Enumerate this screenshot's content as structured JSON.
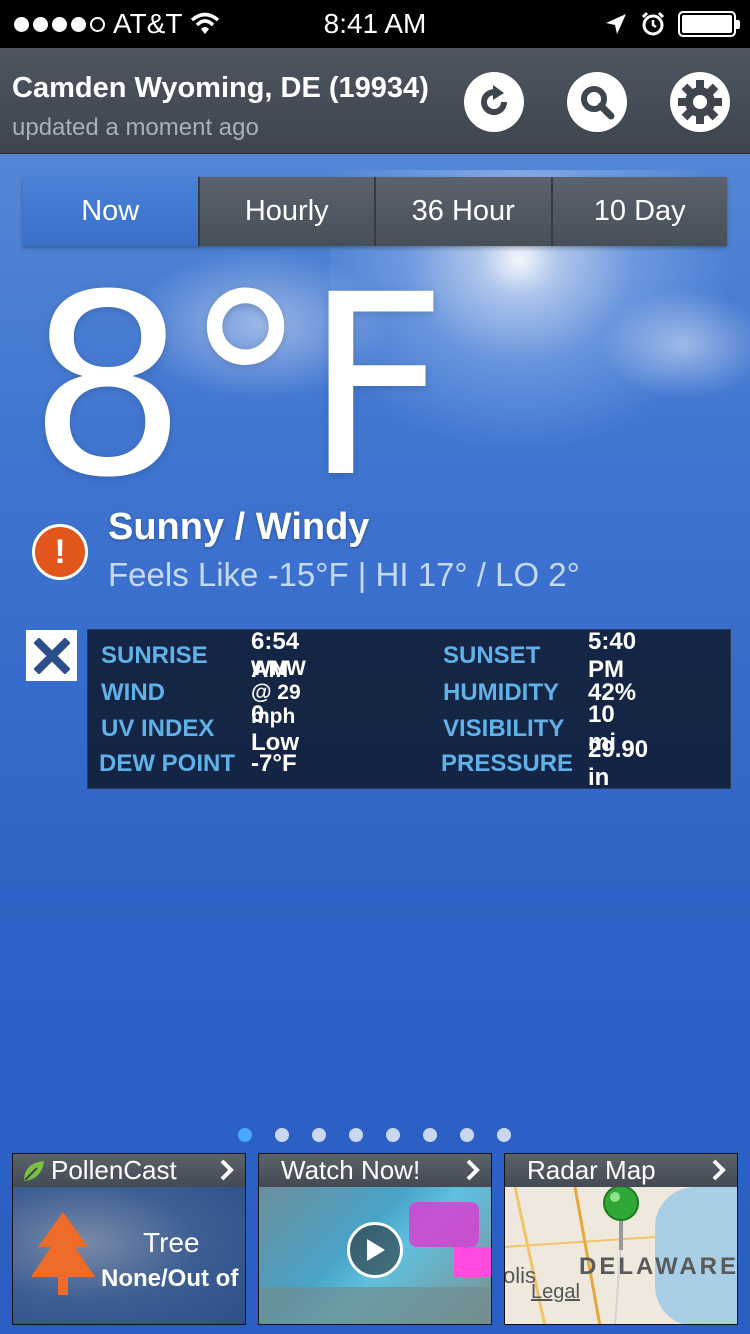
{
  "status_bar": {
    "carrier": "AT&T",
    "time": "8:41 AM"
  },
  "header": {
    "location": "Camden Wyoming, DE (19934)",
    "updated": "updated a moment ago"
  },
  "tabs": [
    {
      "label": "Now",
      "active": true
    },
    {
      "label": "Hourly",
      "active": false
    },
    {
      "label": "36 Hour",
      "active": false
    },
    {
      "label": "10 Day",
      "active": false
    }
  ],
  "current": {
    "temperature": "8°F",
    "condition": "Sunny / Windy",
    "feels_like": "Feels Like -15°F | HI 17° / LO 2°"
  },
  "details": {
    "left": [
      {
        "label": "SUNRISE",
        "value": "6:54 AM"
      },
      {
        "label": "WIND",
        "value": "WNW @ 29 mph"
      },
      {
        "label": "UV INDEX",
        "value": "0 Low"
      },
      {
        "label": "DEW POINT",
        "value": "-7°F"
      }
    ],
    "right": [
      {
        "label": "SUNSET",
        "value": "5:40 PM"
      },
      {
        "label": "HUMIDITY",
        "value": "42%"
      },
      {
        "label": "VISIBILITY",
        "value": "10 mi"
      },
      {
        "label": "PRESSURE",
        "value": "29.90 in"
      }
    ]
  },
  "pager": {
    "count": 8,
    "active_index": 0
  },
  "cards": {
    "pollen": {
      "title": "PollenCast",
      "type": "Tree",
      "level": "None/Out of"
    },
    "video": {
      "title": "Watch Now!"
    },
    "radar": {
      "title": "Radar Map",
      "map_label": "DELAWARE",
      "legal": "Legal",
      "partial_city": "olis"
    }
  },
  "colors": {
    "accent": "#3a6fc8",
    "label_blue": "#5fb1e8",
    "alert_orange": "#e2561c"
  }
}
